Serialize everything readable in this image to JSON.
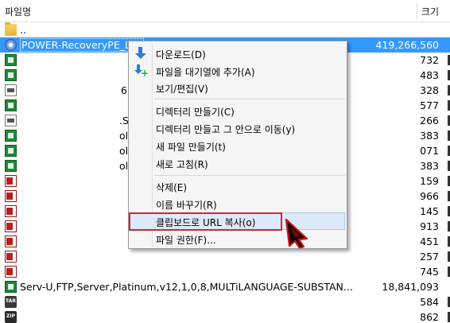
{
  "header": {
    "name_col": "파일명",
    "size_col": "크기"
  },
  "files": [
    {
      "icon": "folder-icon",
      "name": "..",
      "size": ""
    },
    {
      "icon": "disc-image-icon",
      "name": "POWER-RecoveryPE_Li...",
      "size": "419,266,560",
      "selected": true
    },
    {
      "icon": "green-file-icon",
      "name": "",
      "size": "732"
    },
    {
      "icon": "green-file-icon",
      "name": "",
      "size": "483"
    },
    {
      "icon": "doc-icon",
      "name": "6",
      "size": "328"
    },
    {
      "icon": "green-file-icon",
      "name": "",
      "size": "577"
    },
    {
      "icon": "doc-icon",
      "name": ".S",
      "size": "266"
    },
    {
      "icon": "green-file-icon",
      "name": "ol",
      "size": "383"
    },
    {
      "icon": "green-file-icon",
      "name": "ol",
      "size": "071"
    },
    {
      "icon": "green-file-icon",
      "name": "ol",
      "size": "383"
    },
    {
      "icon": "red-file-icon",
      "name": "",
      "size": "159"
    },
    {
      "icon": "red-file-icon",
      "name": "",
      "size": "966"
    },
    {
      "icon": "red-file-icon",
      "name": "",
      "size": "145"
    },
    {
      "icon": "red-file-icon",
      "name": "",
      "size": "913"
    },
    {
      "icon": "red-file-icon",
      "name": "",
      "size": "451"
    },
    {
      "icon": "red-file-icon",
      "name": "",
      "size": "257"
    },
    {
      "icon": "red-file-icon",
      "name": "",
      "size": "745"
    },
    {
      "icon": "green-file-icon",
      "name": "Serv-U,FTP,Server,Platinum,v12,1,0,8,MULTiLANGUAGE-SUBSTAN...",
      "size": "18,841,093"
    },
    {
      "icon": "tar-icon",
      "name": "",
      "size": "584"
    },
    {
      "icon": "zip-icon",
      "name": "",
      "size": "862"
    }
  ],
  "menu": {
    "items": [
      {
        "label": "다운로드(D)",
        "icon": "download-icon"
      },
      {
        "label": "파일을 대기열에 추가(A)",
        "icon": "add-queue-icon"
      },
      {
        "label": "보기/편집(V)"
      },
      {
        "label": "디렉터리 만들기(C)"
      },
      {
        "label": "디렉터리 만들고 그 안으로 이동(y)"
      },
      {
        "label": "새 파일 만들기(t)"
      },
      {
        "label": "새로 고침(R)"
      },
      {
        "label": "삭제(E)"
      },
      {
        "label": "이름 바꾸기(R)"
      },
      {
        "label": "클립보드로 URL 복사(o)",
        "highlighted": true
      },
      {
        "label": "파일 권한(F)..."
      }
    ]
  },
  "colors": {
    "selection": "#3399ff",
    "menu_hover": "#dceaf9",
    "annotation": "#d2262c"
  }
}
